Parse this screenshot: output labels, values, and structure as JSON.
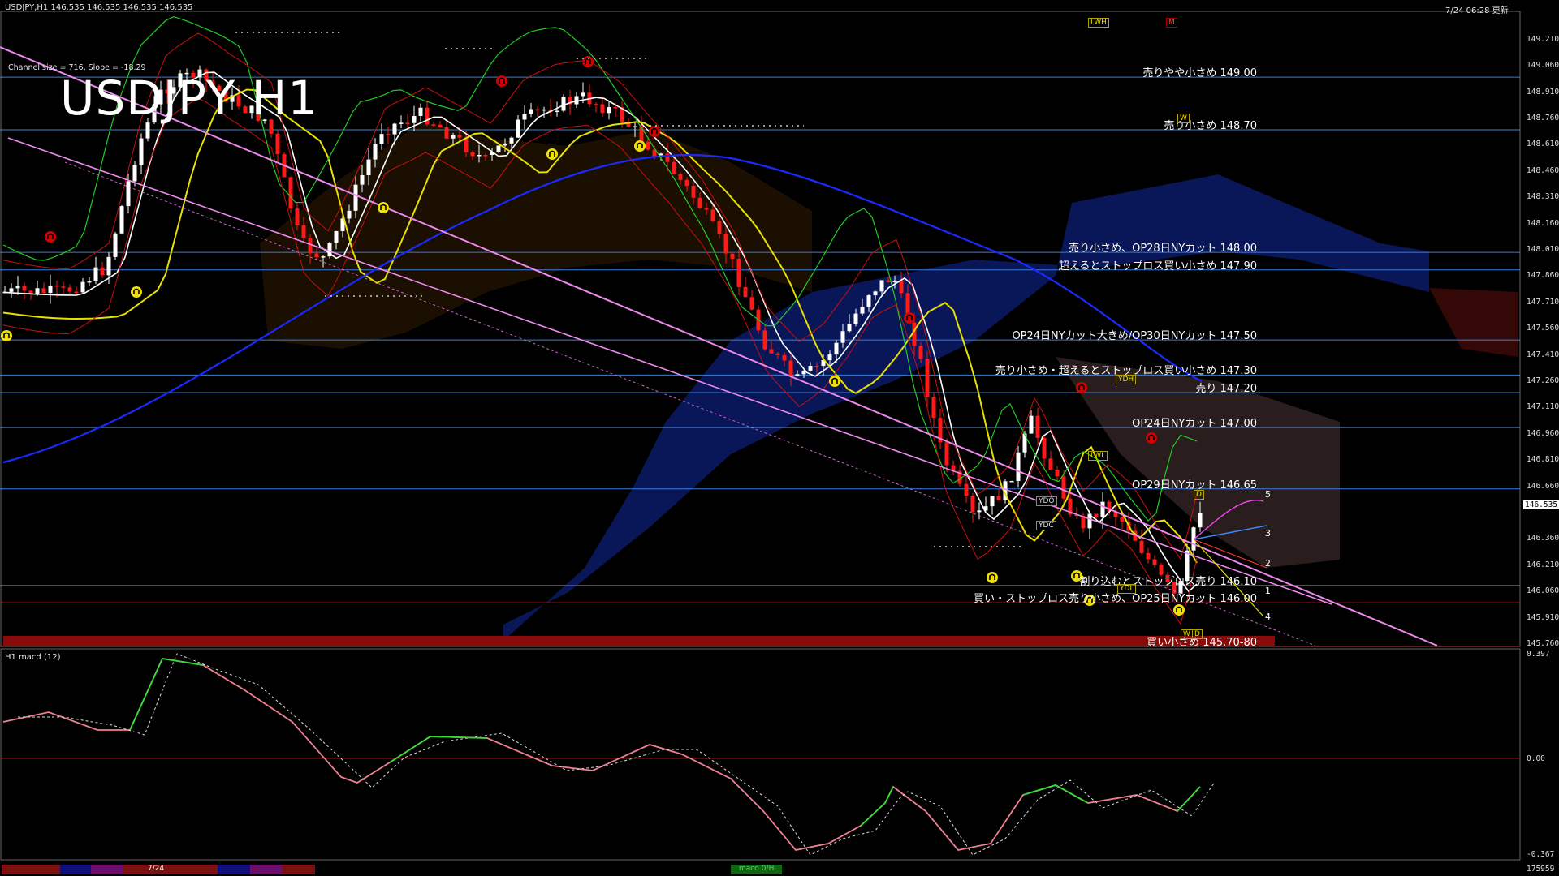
{
  "header": {
    "ohlc_text": "USDJPY,H1 146.535 146.535 146.535 146.535",
    "channel_info": "Channel size = 716, Slope = -18.29",
    "title": "USDJPY H1",
    "datetime": "7/24 06:28 更新"
  },
  "price_axis": {
    "ticks": [
      "149.210",
      "149.060",
      "148.910",
      "148.760",
      "148.610",
      "148.460",
      "148.310",
      "148.160",
      "148.010",
      "147.860",
      "147.710",
      "147.560",
      "147.410",
      "147.260",
      "147.110",
      "146.960",
      "146.810",
      "146.660",
      "146.535",
      "146.360",
      "146.210",
      "146.060",
      "145.910",
      "145.760"
    ],
    "current_price": "146.535"
  },
  "levels": [
    {
      "price": 149.0,
      "label": "売りやや小さめ 149.00",
      "color": "#3a7fd8"
    },
    {
      "price": 148.7,
      "label": "売り小さめ 148.70",
      "color": "#3a7fd8"
    },
    {
      "price": 148.0,
      "label": "売り小さめ、OP28日NYカット 148.00",
      "color": "#3a7fd8"
    },
    {
      "price": 147.9,
      "label": "超えるとストップロス買い小さめ 147.90",
      "color": "#3a7fd8"
    },
    {
      "price": 147.5,
      "label": "OP24日NYカット大きめ/OP30日NYカット 147.50",
      "color": "#3a7fd8"
    },
    {
      "price": 147.3,
      "label": "売り小さめ・超えるとストップロス買い小さめ 147.30",
      "color": "#3a7fd8"
    },
    {
      "price": 147.2,
      "label": "売り 147.20",
      "color": "#3a7fd8"
    },
    {
      "price": 147.0,
      "label": "OP24日NYカット 147.00",
      "color": "#3a7fd8"
    },
    {
      "price": 146.65,
      "label": "OP29日NYカット 146.65",
      "color": "#3a7fd8"
    },
    {
      "price": 146.1,
      "label": "割り込むとストップロス売り 146.10",
      "color": "#c02020"
    },
    {
      "price": 146.0,
      "label": "買い・ストップロス売り小さめ、OP25日NYカット 146.00",
      "color": "#c02020"
    },
    {
      "price": 145.75,
      "label": "買い小さめ 145.70-80",
      "color": "#c02020"
    }
  ],
  "badges": {
    "lwh": "LWH",
    "m": "M",
    "w": "W",
    "ydh": "YDH",
    "lwl": "LWL",
    "ydo": "YDO",
    "ydc": "YDC",
    "ydl": "YDL",
    "wl": "W",
    "d": "D",
    "d2": "D"
  },
  "wave_labels": [
    "5",
    "3",
    "2",
    "1",
    "4"
  ],
  "macd": {
    "title": "H1  macd (12)",
    "top": "0.397",
    "zero": "0.00",
    "bottom": "-0.367"
  },
  "bottom_bar": {
    "date_tab": "7/24",
    "macd_tab": "macd 0/H",
    "counter": "175959"
  }
}
